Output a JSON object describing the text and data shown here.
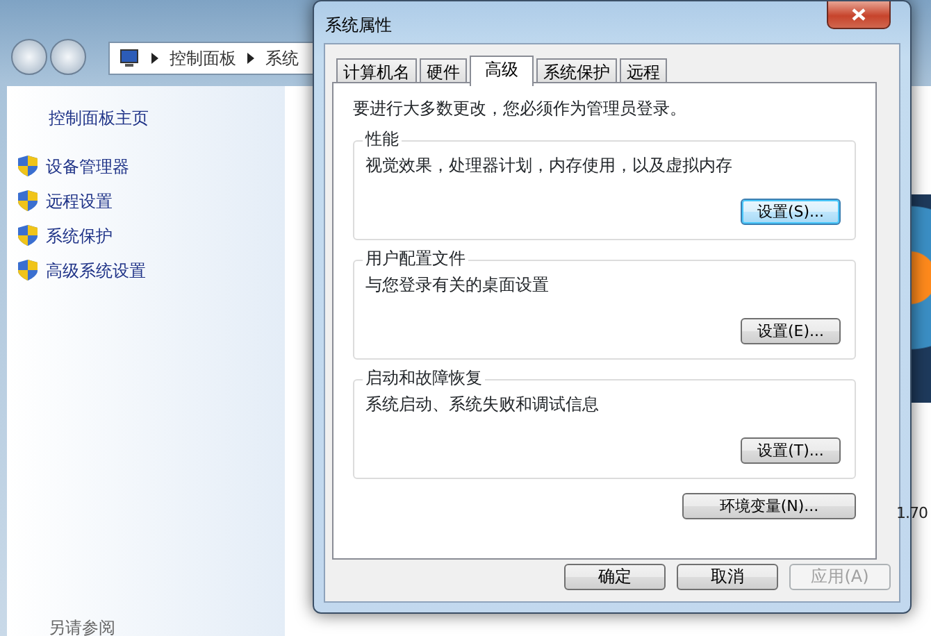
{
  "explorer": {
    "breadcrumb": [
      "控制面板",
      "系统"
    ],
    "sidebar_title": "控制面板主页",
    "sidebar_items": [
      {
        "label": "设备管理器"
      },
      {
        "label": "远程设置"
      },
      {
        "label": "系统保护"
      },
      {
        "label": "高级系统设置"
      }
    ],
    "see_also": "另请参阅",
    "side_value": "1.70"
  },
  "dialog": {
    "title": "系统属性",
    "tabs": [
      {
        "label": "计算机名",
        "selected": false
      },
      {
        "label": "硬件",
        "selected": false
      },
      {
        "label": "高级",
        "selected": true
      },
      {
        "label": "系统保护",
        "selected": false
      },
      {
        "label": "远程",
        "selected": false
      }
    ],
    "notice": "要进行大多数更改，您必须作为管理员登录。",
    "groups": [
      {
        "title": "性能",
        "description": "视觉效果，处理器计划，内存使用，以及虚拟内存",
        "button": {
          "label": "设置(S)...",
          "focused": true
        }
      },
      {
        "title": "用户配置文件",
        "description": "与您登录有关的桌面设置",
        "button": {
          "label": "设置(E)...",
          "focused": false
        }
      },
      {
        "title": "启动和故障恢复",
        "description": "系统启动、系统失败和调试信息",
        "button": {
          "label": "设置(T)...",
          "focused": false
        }
      }
    ],
    "env_button": "环境变量(N)...",
    "buttons": [
      {
        "label": "确定",
        "disabled": false
      },
      {
        "label": "取消",
        "disabled": false
      },
      {
        "label": "应用(A)",
        "disabled": true
      }
    ]
  }
}
